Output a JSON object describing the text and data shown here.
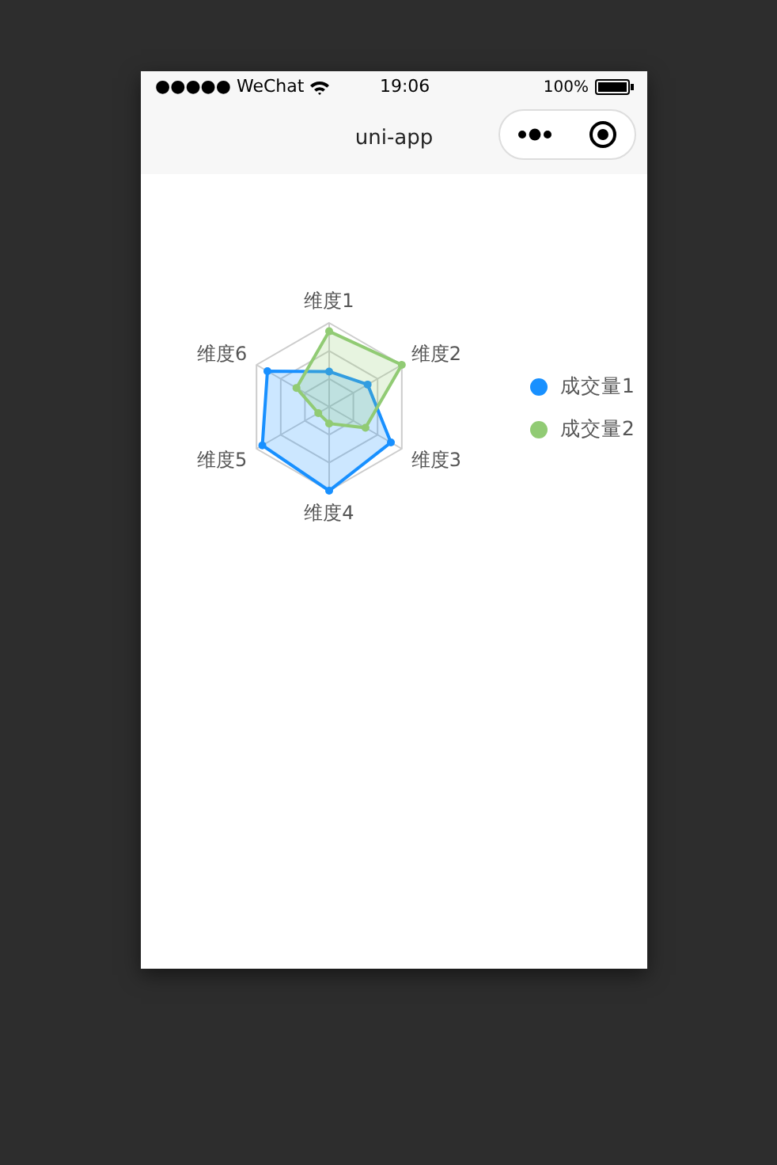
{
  "status_bar": {
    "carrier": "●●●●● WeChat",
    "time": "19:06",
    "battery": "100%"
  },
  "nav_bar": {
    "title": "uni-app"
  },
  "radar_chart": {
    "categories": [
      "维度1",
      "维度2",
      "维度3",
      "维度4",
      "维度5",
      "维度6"
    ],
    "legend": [
      {
        "label": "成交量1",
        "color": "#1890ff"
      },
      {
        "label": "成交量2",
        "color": "#91cb74"
      }
    ]
  }
}
